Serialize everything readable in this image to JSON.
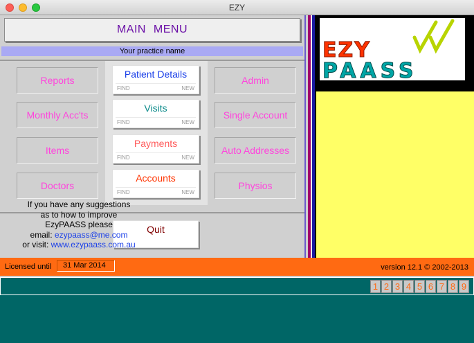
{
  "window": {
    "title": "EZY"
  },
  "menu": {
    "title": "MAIN  MENU",
    "practice_name": "Your practice name",
    "left_buttons": [
      "Reports",
      "Monthly Acc'ts",
      "Items",
      "Doctors"
    ],
    "right_buttons": [
      "Admin",
      "Single Account",
      "Auto Addresses",
      "Physios"
    ],
    "center_buttons": [
      {
        "label": "Patient Details",
        "color": "#1a3fe8",
        "find": "FIND",
        "new": "NEW"
      },
      {
        "label": "Visits",
        "color": "#0a8a8a",
        "find": "FIND",
        "new": "NEW"
      },
      {
        "label": "Payments",
        "color": "#ff5a5a",
        "find": "FIND",
        "new": "NEW"
      },
      {
        "label": "Accounts",
        "color": "#ff3300",
        "find": "FIND",
        "new": "NEW"
      }
    ],
    "quit_label": "Quit"
  },
  "logo": {
    "text_top": "EZY",
    "text_bottom": "PAASS"
  },
  "suggestions": {
    "line1": "If you have any suggestions",
    "line2": "as to how to improve",
    "line3": "EzyPAASS please",
    "email_prefix": "email:",
    "email": "ezypaass@me.com",
    "visit_prefix": "or visit:",
    "url": "www.ezypaass.com.au"
  },
  "license": {
    "label": "Licensed until",
    "date": "31 Mar 2014",
    "version": "version 12.1 © 2002-2013"
  },
  "pages": [
    "1",
    "2",
    "3",
    "4",
    "5",
    "6",
    "7",
    "8",
    "9"
  ],
  "colors": {
    "accent_purple": "#6a0ea6",
    "pink": "#ff44dd",
    "orange": "#ff6a12",
    "teal": "#006666",
    "yellow": "#ffff66"
  }
}
